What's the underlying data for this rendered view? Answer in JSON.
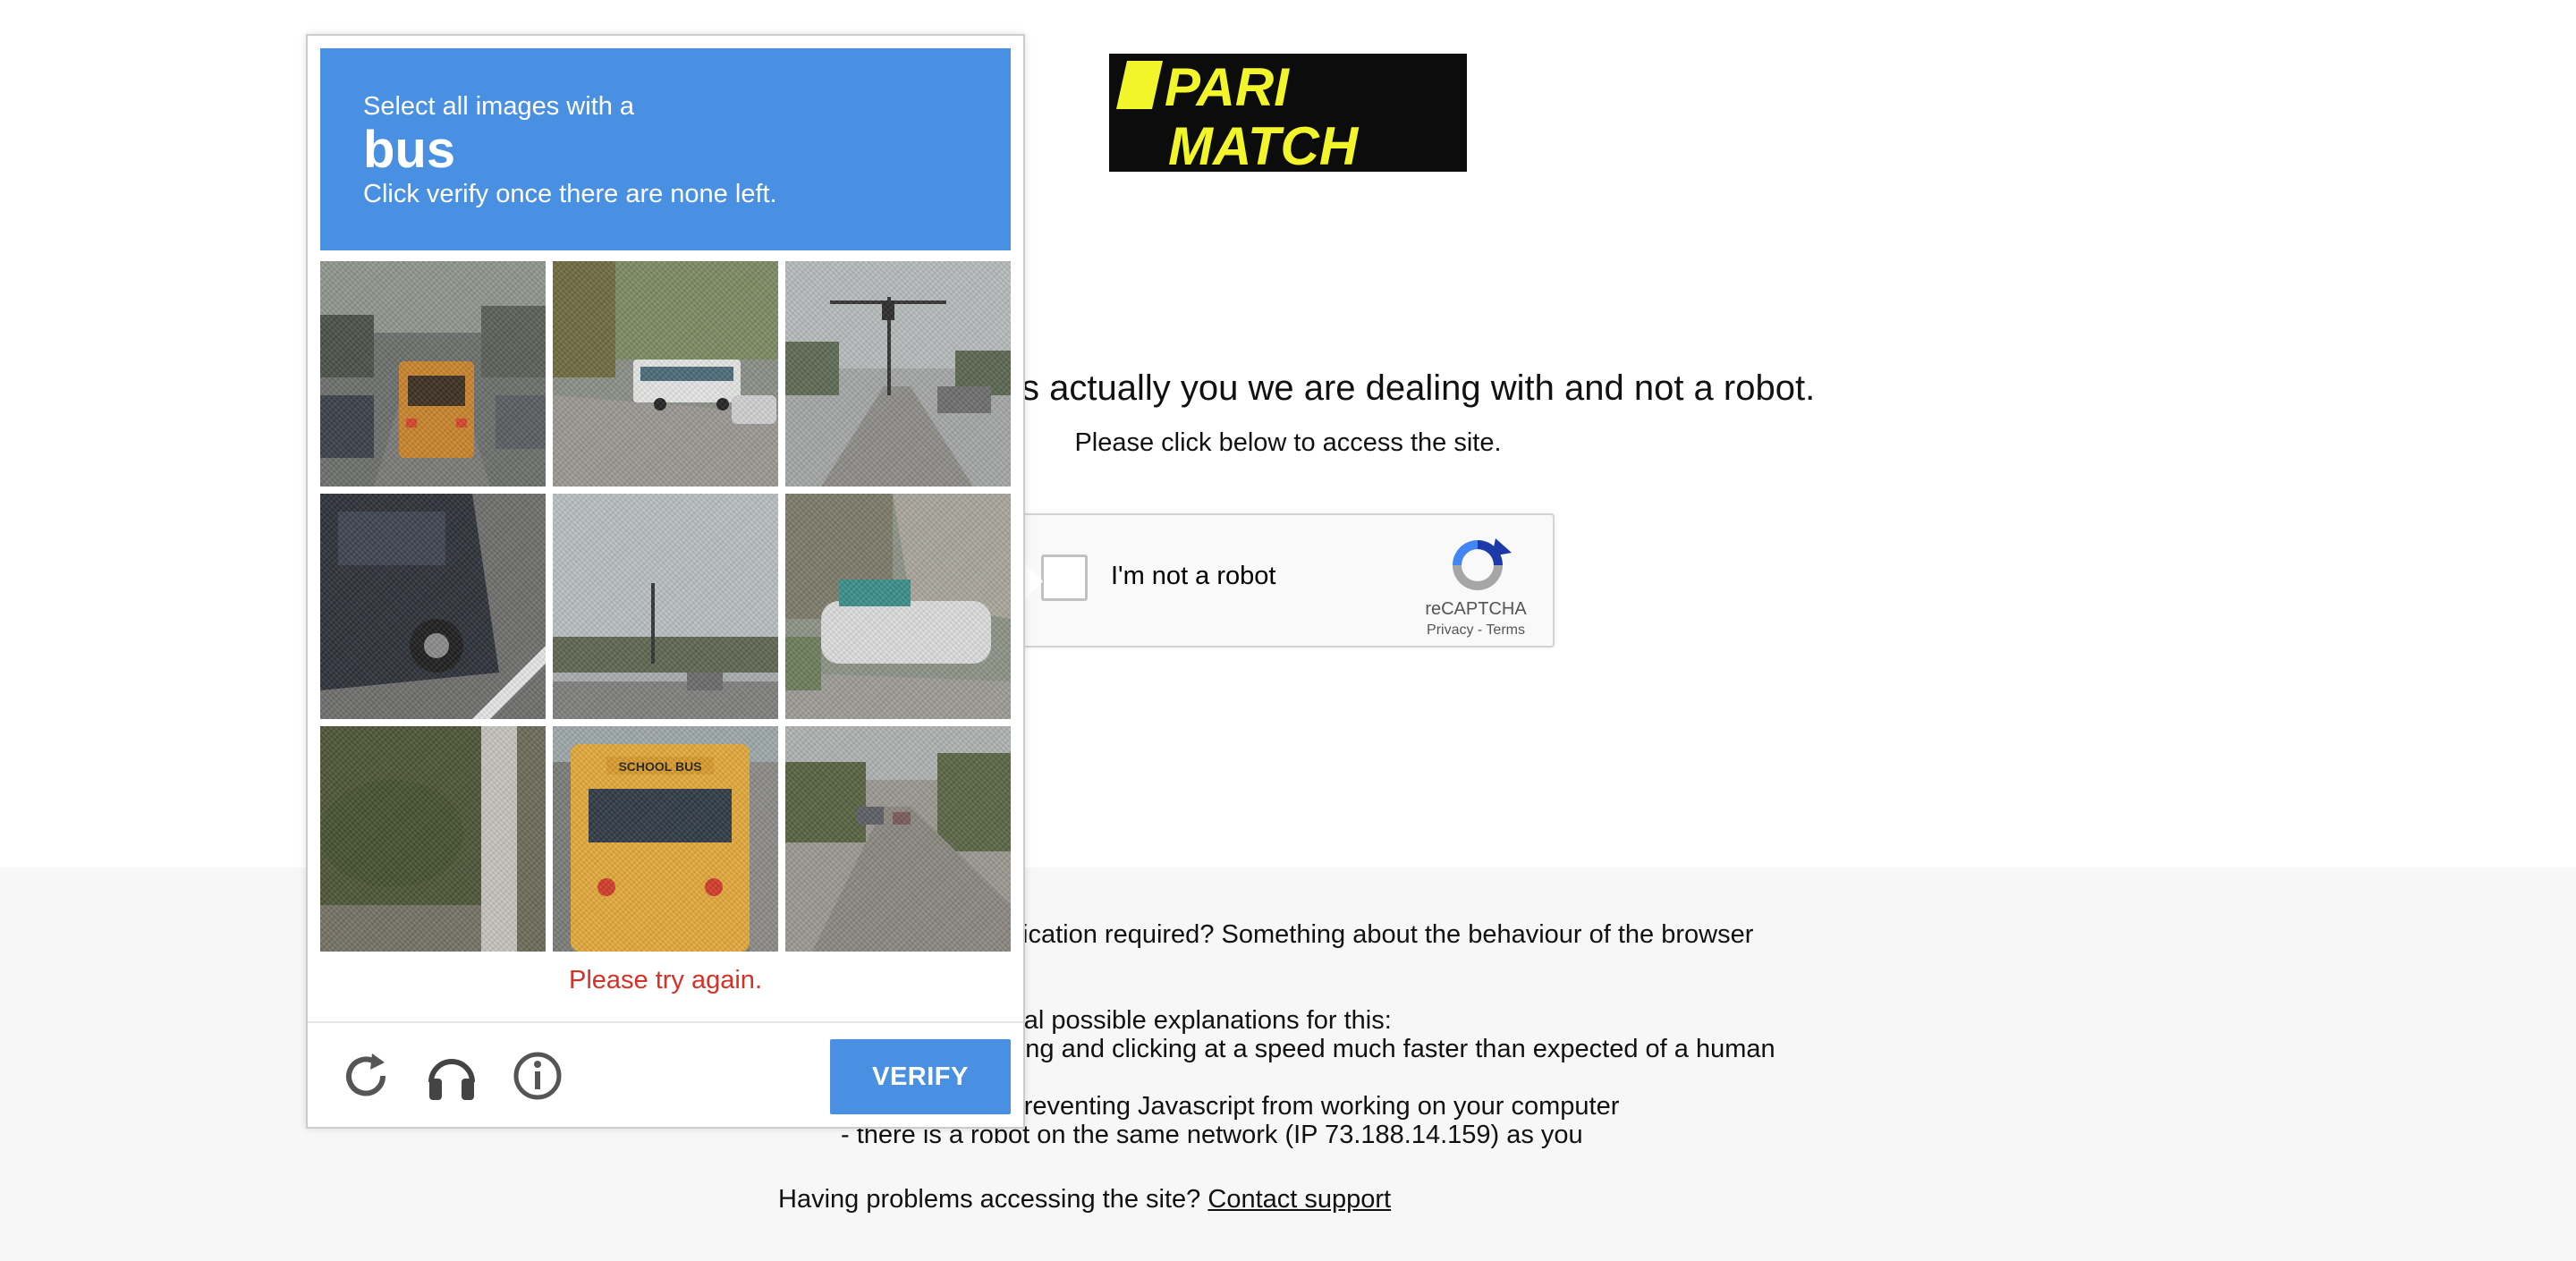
{
  "page": {
    "headline": "To make sure it is actually you we are dealing with and not a robot.",
    "subline": "Please click below to access the site.",
    "logo_text_line1": "PARI",
    "logo_text_line2": "MATCH"
  },
  "recaptcha_widget": {
    "label": "I'm not a robot",
    "brand": "reCAPTCHA",
    "terms": "Privacy - Terms"
  },
  "footer": {
    "line1": "Why is this verification required? Something about the behaviour of the browser has caught",
    "line3": "There are several possible explanations for this:",
    "line4": "- you are browsing and clicking at a speed much faster than expected of a human",
    "line6": "- something is preventing Javascript from working on your computer",
    "line7": "- there is a robot on the same network (IP 73.188.14.159) as you",
    "support_prefix": "Having problems accessing the site?",
    "support_link": "Contact support"
  },
  "challenge": {
    "instruction_line1": "Select all images with a",
    "target": "bus",
    "instruction_line2": "Click verify once there are none left.",
    "error": "Please try again.",
    "verify_label": "VERIFY",
    "tiles": [
      {
        "name": "tile-1",
        "desc": "school bus on road"
      },
      {
        "name": "tile-2",
        "desc": "white bus on street"
      },
      {
        "name": "tile-3",
        "desc": "street with traffic lights"
      },
      {
        "name": "tile-4",
        "desc": "dark car"
      },
      {
        "name": "tile-5",
        "desc": "sky and street"
      },
      {
        "name": "tile-6",
        "desc": "boat on trailer"
      },
      {
        "name": "tile-7",
        "desc": "tree and bushes"
      },
      {
        "name": "tile-8",
        "desc": "yellow school bus"
      },
      {
        "name": "tile-9",
        "desc": "road with cars"
      }
    ],
    "icons": [
      "reload-icon",
      "headphones-icon",
      "info-icon"
    ],
    "accent_color": "#4a90e2",
    "error_color": "#d93025"
  }
}
